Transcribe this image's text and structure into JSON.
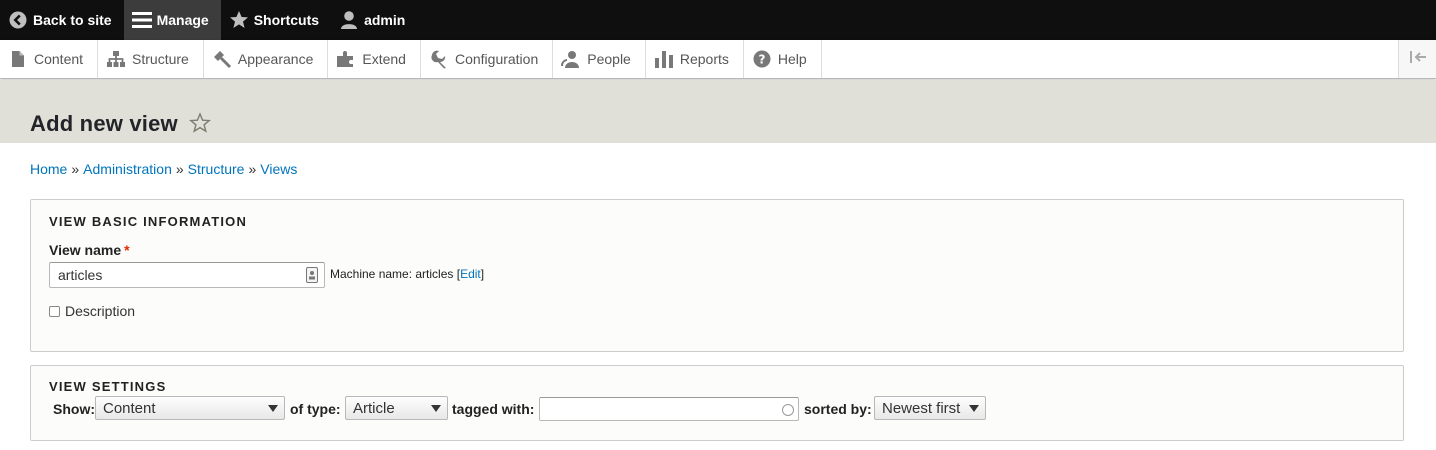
{
  "toolbar": {
    "back_label": "Back to site",
    "manage_label": "Manage",
    "shortcuts_label": "Shortcuts",
    "user_label": "admin"
  },
  "tray": {
    "items": [
      {
        "label": "Content",
        "icon": "file-icon"
      },
      {
        "label": "Structure",
        "icon": "sitemap-icon"
      },
      {
        "label": "Appearance",
        "icon": "paintbrush-icon"
      },
      {
        "label": "Extend",
        "icon": "puzzle-icon"
      },
      {
        "label": "Configuration",
        "icon": "wrench-icon"
      },
      {
        "label": "People",
        "icon": "people-icon"
      },
      {
        "label": "Reports",
        "icon": "bar-chart-icon"
      },
      {
        "label": "Help",
        "icon": "help-icon"
      }
    ]
  },
  "page": {
    "title": "Add new view"
  },
  "breadcrumb": {
    "items": [
      "Home",
      "Administration",
      "Structure",
      "Views"
    ],
    "separator": "»"
  },
  "basic_info": {
    "legend": "VIEW BASIC INFORMATION",
    "view_name_label": "View name",
    "required_mark": "*",
    "view_name_value": "articles",
    "machine_name_text": "Machine name: articles",
    "edit_link": "Edit",
    "description_label": "Description",
    "description_checked": false
  },
  "view_settings": {
    "legend": "VIEW SETTINGS",
    "show_label": "Show:",
    "show_value": "Content",
    "type_label": "of type:",
    "type_value": "Article",
    "tagged_label": "tagged with:",
    "tagged_value": "",
    "sorted_label": "sorted by:",
    "sorted_value": "Newest first"
  },
  "colors": {
    "toolbar_bg": "#0f0f0f",
    "active_tab": "#3c3c3c",
    "link": "#0074bd",
    "header_bg": "#e0e0d8",
    "required": "#e62600"
  }
}
